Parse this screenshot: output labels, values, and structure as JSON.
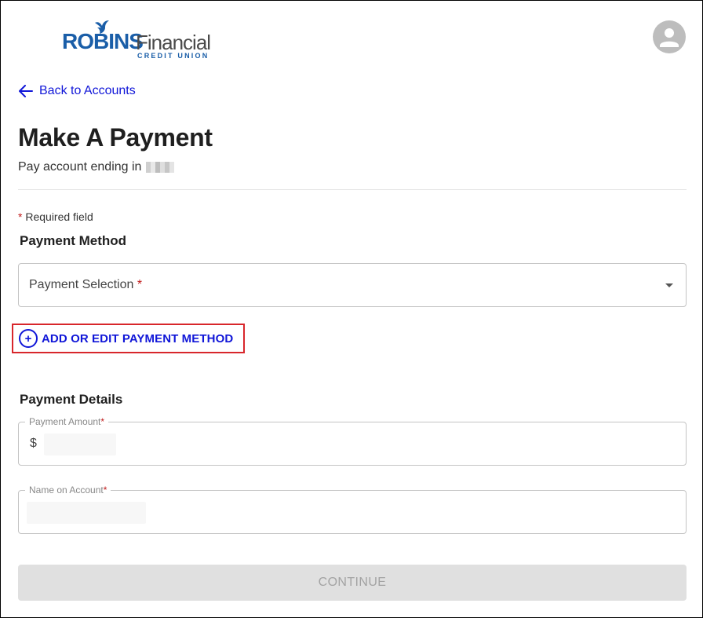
{
  "brand": {
    "name_part1": "ROBINS",
    "name_part2": "Financial",
    "tagline": "CREDIT UNION",
    "primary_color": "#1a5ea8"
  },
  "header": {
    "avatar_icon": "user-avatar-icon"
  },
  "nav": {
    "back_label": "Back to Accounts",
    "back_icon": "arrow-left-icon",
    "link_color": "#1016d8"
  },
  "page": {
    "title": "Make A Payment",
    "subtitle": "Pay account ending in"
  },
  "form": {
    "required_star": "*",
    "required_note": "Required field",
    "payment_method_heading": "Payment Method",
    "payment_selection_label": "Payment Selection",
    "add_edit_label": "ADD OR EDIT PAYMENT METHOD",
    "add_edit_icon": "add-circle-icon",
    "highlight_color": "#d8262b",
    "payment_details_heading": "Payment Details",
    "payment_amount_label": "Payment Amount",
    "currency_prefix": "$",
    "name_on_account_label": "Name on Account",
    "continue_label": "CONTINUE"
  }
}
